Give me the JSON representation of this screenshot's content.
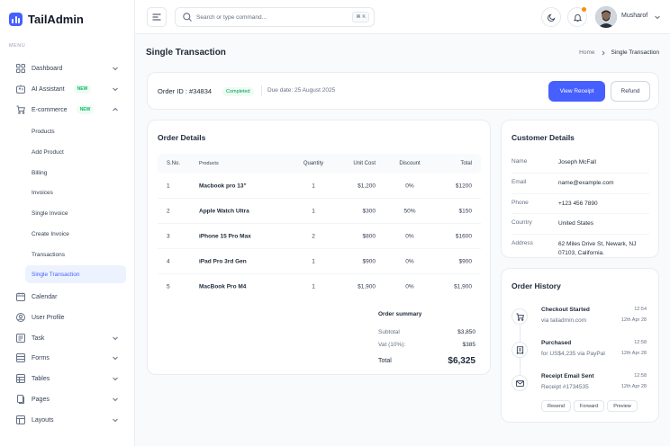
{
  "app": {
    "name": "TailAdmin"
  },
  "sidebar": {
    "menu_caption": "MENU",
    "items": [
      {
        "label": "Dashboard",
        "icon": "grid-icon",
        "chevron": "down"
      },
      {
        "label": "AI Assistant",
        "icon": "ai-icon",
        "badge": "NEW",
        "chevron": "down"
      },
      {
        "label": "E-commerce",
        "icon": "cart-icon",
        "badge": "NEW",
        "chevron": "up"
      },
      {
        "label": "Calendar",
        "icon": "calendar-icon"
      },
      {
        "label": "User Profile",
        "icon": "user-circle-icon"
      },
      {
        "label": "Task",
        "icon": "task-icon",
        "chevron": "down"
      },
      {
        "label": "Forms",
        "icon": "forms-icon",
        "chevron": "down"
      },
      {
        "label": "Tables",
        "icon": "table-icon",
        "chevron": "down"
      },
      {
        "label": "Pages",
        "icon": "pages-icon",
        "chevron": "down"
      },
      {
        "label": "Layouts",
        "icon": "layouts-icon",
        "chevron": "down"
      }
    ],
    "ecommerce_sub": [
      "Products",
      "Add Product",
      "Billing",
      "Invoices",
      "Single Invoice",
      "Create Invoice",
      "Transactions",
      "Single Transaction"
    ],
    "active_sub": "Single Transaction"
  },
  "header": {
    "search_placeholder": "Search or type command...",
    "search_shortcut": "⌘ K",
    "user_name": "Musharof"
  },
  "page": {
    "title": "Single Transaction",
    "breadcrumb": {
      "home": "Home",
      "current": "Single Transaction"
    }
  },
  "order": {
    "id_label": "Order ID : #34834",
    "status": "Completed",
    "due_date": "Due date: 25 August 2025",
    "view_receipt": "View Receipt",
    "refund": "Refund"
  },
  "order_details": {
    "title": "Order Details",
    "columns": {
      "sno": "S.No.",
      "product": "Products",
      "qty": "Quantity",
      "unit": "Unit Cost",
      "discount": "Discount",
      "total": "Total"
    },
    "rows": [
      {
        "sno": "1",
        "product": "Macbook pro 13\"",
        "qty": "1",
        "unit": "$1,200",
        "discount": "0%",
        "total": "$1200"
      },
      {
        "sno": "2",
        "product": "Apple Watch Ultra",
        "qty": "1",
        "unit": "$300",
        "discount": "50%",
        "total": "$150"
      },
      {
        "sno": "3",
        "product": "iPhone 15 Pro Max",
        "qty": "2",
        "unit": "$800",
        "discount": "0%",
        "total": "$1600"
      },
      {
        "sno": "4",
        "product": "iPad Pro 3rd Gen",
        "qty": "1",
        "unit": "$900",
        "discount": "0%",
        "total": "$900"
      },
      {
        "sno": "5",
        "product": "MacBook Pro M4",
        "qty": "1",
        "unit": "$1,900",
        "discount": "0%",
        "total": "$1,900"
      }
    ],
    "summary": {
      "title": "Order summary",
      "subtotal_label": "Subtotal",
      "subtotal": "$3,850",
      "vat_label": "Vat (10%):",
      "vat": "$385",
      "total_label": "Total",
      "total": "$6,325"
    }
  },
  "customer": {
    "title": "Customer Details",
    "rows": [
      {
        "key": "Name",
        "value": "Joseph McFall"
      },
      {
        "key": "Email",
        "value": "name@example.com"
      },
      {
        "key": "Phone",
        "value": "+123 456 7890"
      },
      {
        "key": "Country",
        "value": "United States"
      },
      {
        "key": "Address",
        "value": "62 Miles Drive St, Newark, NJ 07103, California."
      }
    ]
  },
  "history": {
    "title": "Order History",
    "events": [
      {
        "title": "Checkout Started",
        "sub": "via tailadmin.com",
        "time": "12:54",
        "date": "12th Apr 28",
        "icon": "cart-icon"
      },
      {
        "title": "Purchased",
        "sub": "for US$4,235 via PayPal",
        "time": "12:58",
        "date": "12th Apr 28",
        "icon": "receipt-icon"
      },
      {
        "title": "Receipt Email Sent",
        "sub": "Receipt #1734535",
        "time": "12:58",
        "date": "12th Apr 28",
        "icon": "mail-icon"
      }
    ],
    "actions": {
      "resend": "Resend",
      "forward": "Forward",
      "preview": "Preview"
    }
  },
  "colors": {
    "primary": "#465fff",
    "success": "#12b76a",
    "warning": "#f79009"
  }
}
